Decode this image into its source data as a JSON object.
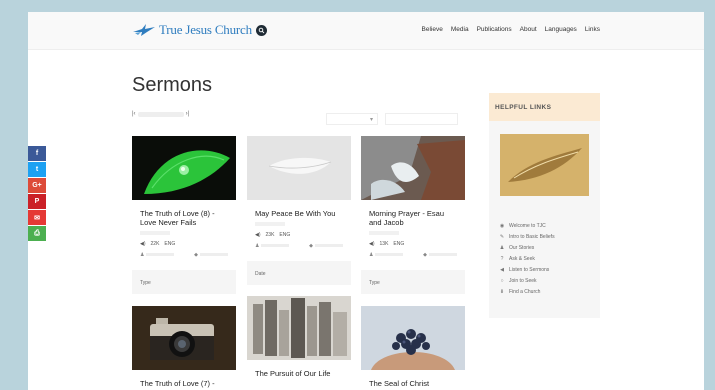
{
  "header": {
    "logo_text": "True Jesus Church",
    "nav": [
      "Believe",
      "Media",
      "Publications",
      "About",
      "Languages",
      "Links"
    ]
  },
  "social": [
    "f",
    "t",
    "G+",
    "P",
    "✉",
    "⎙"
  ],
  "page": {
    "title": "Sermons"
  },
  "cards": [
    {
      "title": "The Truth of Love (8) - Love Never Fails",
      "tags": [
        "22K",
        "ENG"
      ],
      "footer": "Type"
    },
    {
      "title": "May Peace Be With You",
      "tags": [
        "23K",
        "ENG"
      ],
      "footer": "Date"
    },
    {
      "title": "Morning Prayer - Esau and Jacob",
      "tags": [
        "13K",
        "ENG"
      ],
      "footer": "Type"
    },
    {
      "title": "The Truth of Love (7) -"
    },
    {
      "title": "The Pursuit of Our Life"
    },
    {
      "title": "The Seal of Christ"
    }
  ],
  "helpful": {
    "heading": "HELPFUL LINKS",
    "links": [
      {
        "icon": "eye-icon",
        "label": "Welcome to TJC"
      },
      {
        "icon": "wrench-icon",
        "label": "Intro to Basic Beliefs"
      },
      {
        "icon": "user-icon",
        "label": "Our Stories"
      },
      {
        "icon": "question-icon",
        "label": "Ask & Seek"
      },
      {
        "icon": "speaker-icon",
        "label": "Listen to Sermons"
      },
      {
        "icon": "clock-icon",
        "label": "Join to Seek"
      },
      {
        "icon": "pin-icon",
        "label": "Find a Church"
      }
    ]
  },
  "colors": {
    "background": "#b9d3dc",
    "brand": "#2f7dbf",
    "facebook": "#3b5998",
    "twitter": "#1da1f2",
    "googleplus": "#dd4b39",
    "pinterest": "#cb2027",
    "mail": "#e53935",
    "print": "#4caf50",
    "helpful_head": "#fbead3"
  }
}
